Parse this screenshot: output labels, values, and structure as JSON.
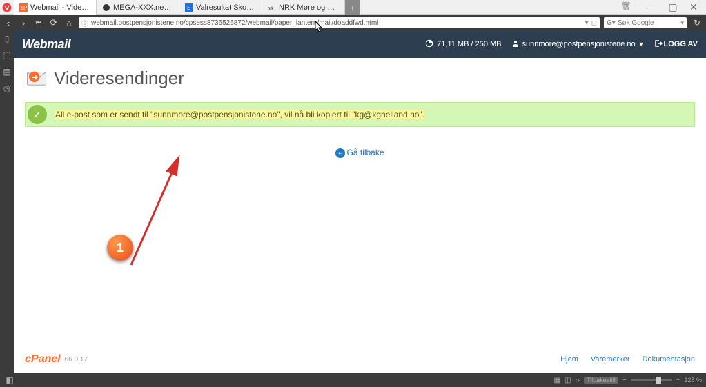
{
  "window": {
    "tabs": [
      {
        "label": "Webmail - Videresendinger",
        "active": true
      },
      {
        "label": "MEGA-XXX.net - Порно ви…",
        "active": false
      },
      {
        "label": "Valresultat Skodje kommu…",
        "active": false
      },
      {
        "label": "NRK Møre og Romsdal – Lo…",
        "active": false
      }
    ],
    "controls": {
      "minimize": "—",
      "maximize": "▢",
      "close": "✕"
    }
  },
  "nav": {
    "url": "webmail.postpensjonistene.no/cpsess8736526872/webmail/paper_lantern/mail/doaddfwd.html",
    "search_placeholder": "Søk Google"
  },
  "webmail": {
    "logo": "Webmail",
    "disk": "71,11 MB / 250 MB",
    "user": "sunnmore@postpensjonistene.no",
    "logout": "LOGG AV"
  },
  "page": {
    "title": "Videresendinger",
    "alert_prefix": "All e-post som er sendt til \"sunnmore@postpensjonistene.no\", vil nå bli kopiert til \"kg@kghelland.no\".",
    "goback": "Gå tilbake"
  },
  "annotation": {
    "badge": "1"
  },
  "footer": {
    "logo": "cPanel",
    "version": "66.0.17",
    "links": [
      "Hjem",
      "Varemerker",
      "Dokumentasjon"
    ]
  },
  "statusbar": {
    "zoom_reset": "Tilbakestill",
    "zoom_pct": "125 %"
  }
}
